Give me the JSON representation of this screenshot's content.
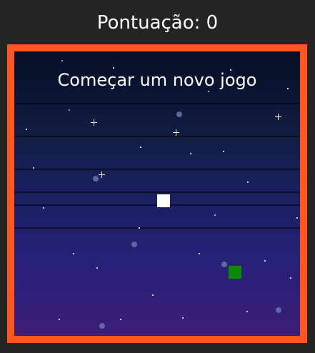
{
  "header": {
    "score_label": "Pontuação: 0"
  },
  "game": {
    "start_label": "Começar um novo jogo",
    "border_color": "#ff5722",
    "player_color": "#ffffff",
    "target_color": "#0a8c0a"
  }
}
